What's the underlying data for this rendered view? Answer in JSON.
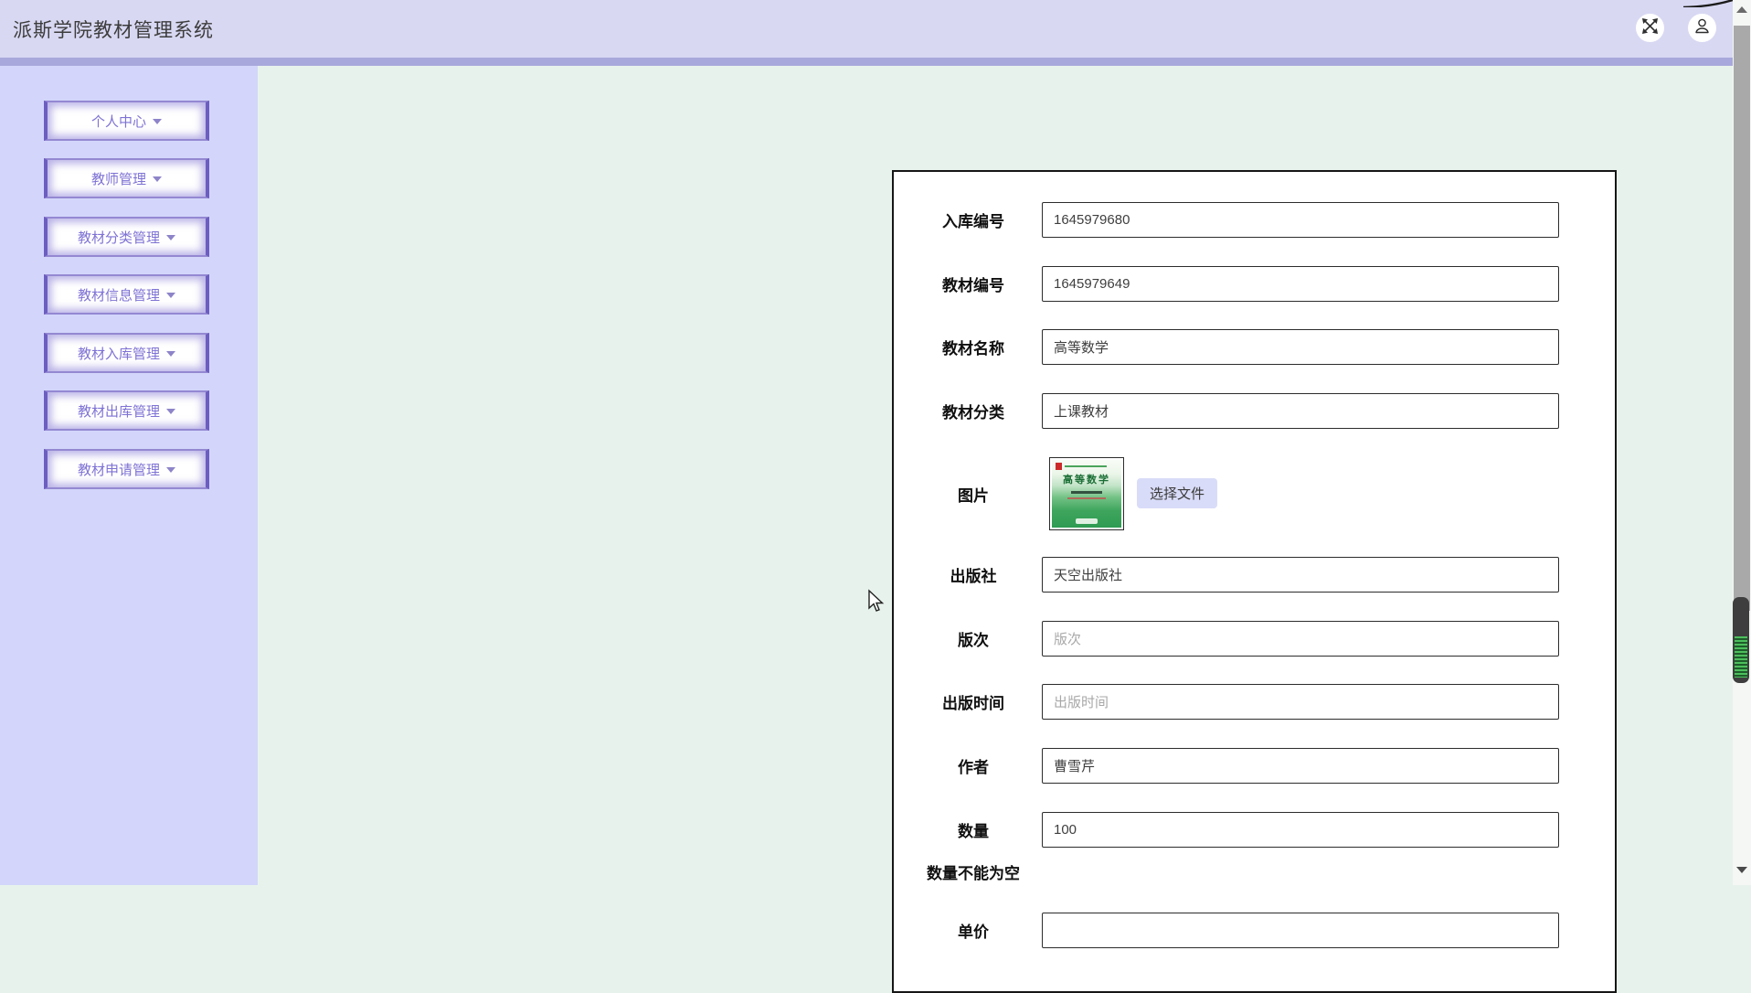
{
  "app": {
    "title": "派斯学院教材管理系统"
  },
  "header": {
    "buttons": [
      {
        "name": "fullscreen",
        "icon": "expand-arrows-icon"
      },
      {
        "name": "profile",
        "icon": "user-icon"
      }
    ]
  },
  "sidebar": {
    "items": [
      {
        "label": "个人中心"
      },
      {
        "label": "教师管理"
      },
      {
        "label": "教材分类管理"
      },
      {
        "label": "教材信息管理"
      },
      {
        "label": "教材入库管理"
      },
      {
        "label": "教材出库管理"
      },
      {
        "label": "教材申请管理"
      }
    ]
  },
  "form": {
    "rows": [
      {
        "label": "入库编号",
        "value": "1645979680"
      },
      {
        "label": "教材编号",
        "value": "1645979649"
      },
      {
        "label": "教材名称",
        "value": "高等数学"
      },
      {
        "label": "教材分类",
        "value": "上课教材"
      },
      {
        "label": "图片",
        "button": "选择文件",
        "preview_title": "高等数学"
      },
      {
        "label": "出版社",
        "value": "天空出版社"
      },
      {
        "label": "版次",
        "value": "",
        "placeholder": "版次"
      },
      {
        "label": "出版时间",
        "value": "",
        "placeholder": "出版时间"
      },
      {
        "label": "作者",
        "value": "曹雪芹"
      },
      {
        "label": "数量",
        "value": "100",
        "error": "数量不能为空"
      },
      {
        "label": "单价",
        "value": ""
      }
    ]
  },
  "colors": {
    "header_bg": "#d8d8f3",
    "header_strip": "#a8a8dc",
    "sidebar_bg": "#d3d6fa",
    "main_bg": "#e8f2ec",
    "sidebar_accent": "#6c5ec0",
    "sidebar_text": "#7e72d4",
    "choose_button_bg": "#d9dcf8",
    "scroll_green": "#4cbf5c",
    "book_cover_green": "#2f9b52"
  }
}
